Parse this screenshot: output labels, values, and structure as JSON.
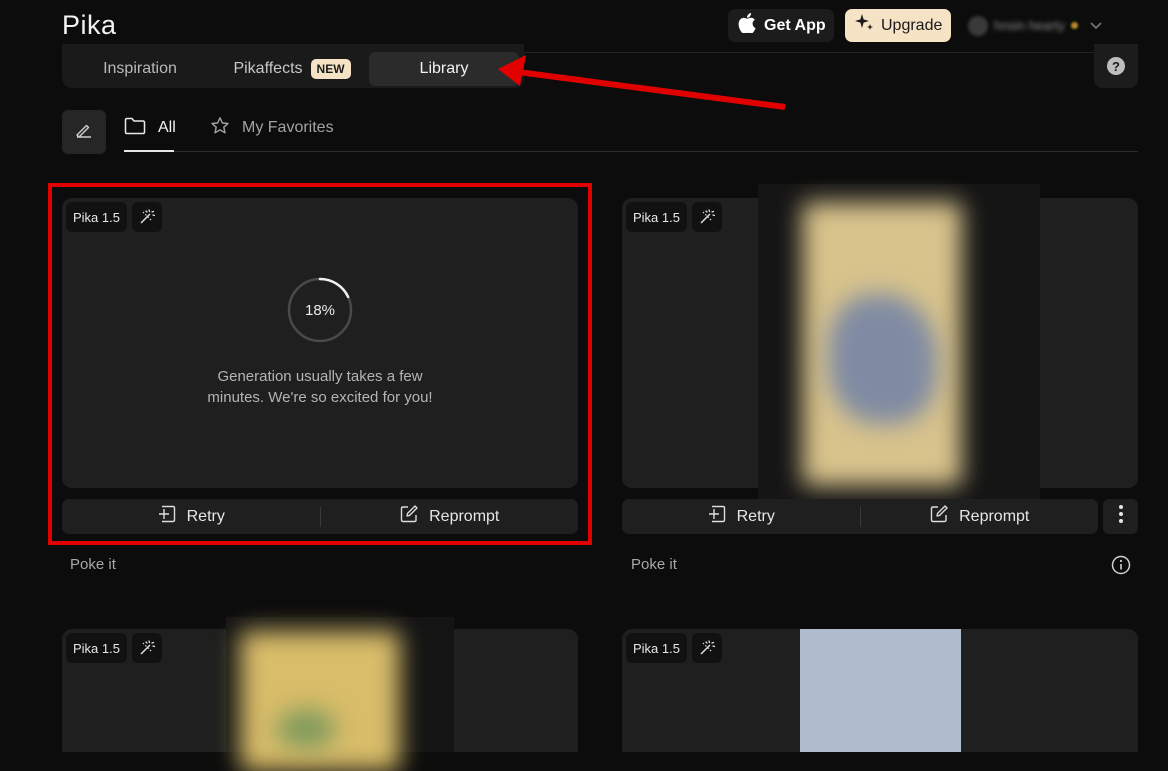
{
  "header": {
    "logo": "Pika",
    "get_app_label": "Get App",
    "upgrade_label": "Upgrade",
    "user_name": "hnsin hearty"
  },
  "nav": {
    "tabs": [
      {
        "label": "Inspiration"
      },
      {
        "label": "Pikaffects",
        "badge": "NEW"
      },
      {
        "label": "Library",
        "active": true
      }
    ],
    "help": "?"
  },
  "subtabs": {
    "all": "All",
    "favorites": "My Favorites"
  },
  "cards": [
    {
      "model": "Pika 1.5",
      "progress_label": "18%",
      "progress": 0.18,
      "message": "Generation usually takes a few minutes. We're so excited for you!",
      "retry": "Retry",
      "reprompt": "Reprompt",
      "caption": "Poke it"
    },
    {
      "model": "Pika 1.5",
      "retry": "Retry",
      "reprompt": "Reprompt",
      "caption": "Poke it"
    },
    {
      "model": "Pika 1.5"
    },
    {
      "model": "Pika 1.5"
    }
  ],
  "colors": {
    "background": "#0c0c0c",
    "card": "#1f1f1f",
    "accent": "#f6e3c6",
    "annotation": "#e10000"
  }
}
